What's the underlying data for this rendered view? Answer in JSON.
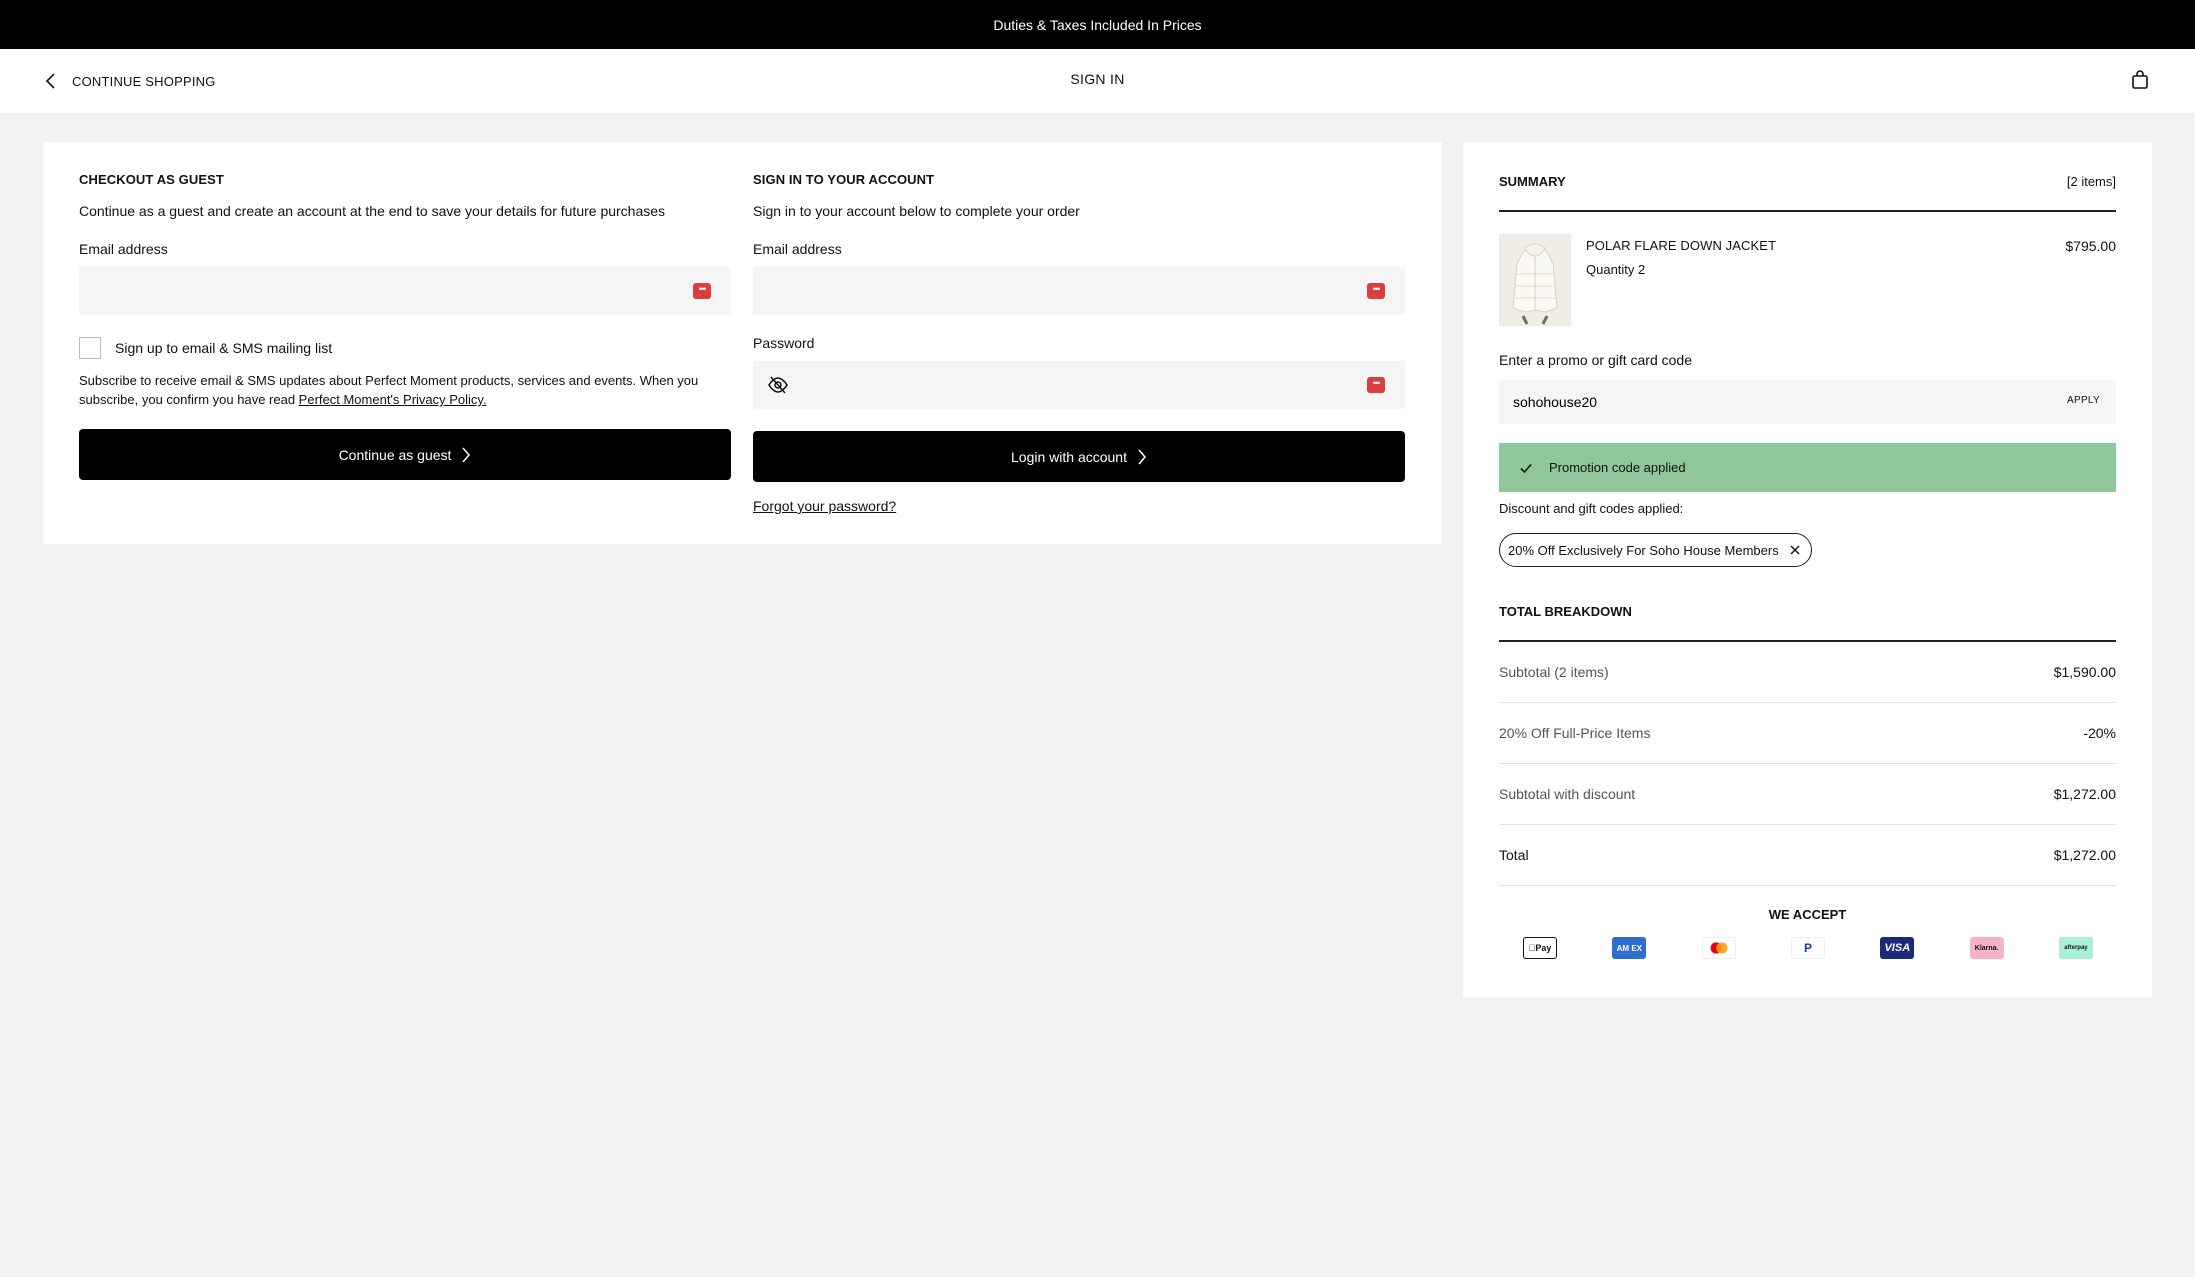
{
  "banner": {
    "text": "Duties & Taxes Included In Prices"
  },
  "nav": {
    "back_label": "CONTINUE SHOPPING",
    "title": "SIGN IN",
    "bag_icon": "shopping-bag-icon"
  },
  "guest": {
    "title": "CHECKOUT AS GUEST",
    "description": "Continue as a guest and create an account at the end to save your details for future purchases",
    "email_label": "Email address",
    "email_value": "",
    "mailing_label": "Sign up to email & SMS mailing list",
    "fine_print": "Subscribe to receive email & SMS updates about Perfect Moment products, services and events. When you subscribe, you confirm you have read ",
    "privacy_link": "Perfect Moment's Privacy Policy.",
    "button_label": "Continue as guest"
  },
  "account": {
    "title": "SIGN IN TO YOUR ACCOUNT",
    "description": "Sign in to your account below to complete your order",
    "email_label": "Email address",
    "email_value": "",
    "password_label": "Password",
    "password_value": "",
    "button_label": "Login with account",
    "forgot_label": "Forgot your password?"
  },
  "summary": {
    "title": "SUMMARY",
    "count": "[2 items]",
    "product": {
      "name": "POLAR FLARE DOWN JACKET",
      "quantity": "Quantity 2",
      "price": "$795.00"
    },
    "promo_label": "Enter a promo or gift card code",
    "promo_value": "sohohouse20",
    "apply_label": "APPLY",
    "success_message": "Promotion code applied",
    "discounts_label": "Discount and gift codes applied:",
    "discount_chip": "20% Off Exclusively For Soho House Members",
    "breakdown_title": "TOTAL BREAKDOWN",
    "rows": [
      {
        "label": "Subtotal (2 items)",
        "value": "$1,590.00"
      },
      {
        "label": "20% Off Full-Price Items",
        "value": "-20%"
      },
      {
        "label": "Subtotal with discount",
        "value": "$1,272.00"
      },
      {
        "label": "Total",
        "value": "$1,272.00"
      }
    ],
    "we_accept": "WE ACCEPT",
    "payment_methods": [
      {
        "name": "apple-pay-icon",
        "text": "Pay"
      },
      {
        "name": "amex-icon",
        "text": "AM EX"
      },
      {
        "name": "mastercard-icon",
        "text": ""
      },
      {
        "name": "paypal-icon",
        "text": "P"
      },
      {
        "name": "visa-icon",
        "text": "VISA"
      },
      {
        "name": "klarna-icon",
        "text": "Klarna."
      },
      {
        "name": "afterpay-icon",
        "text": "afterpay"
      }
    ]
  },
  "colors": {
    "banner_bg": "#000000",
    "success_bg": "#8fc79a",
    "password_key": "#d93f3f"
  }
}
